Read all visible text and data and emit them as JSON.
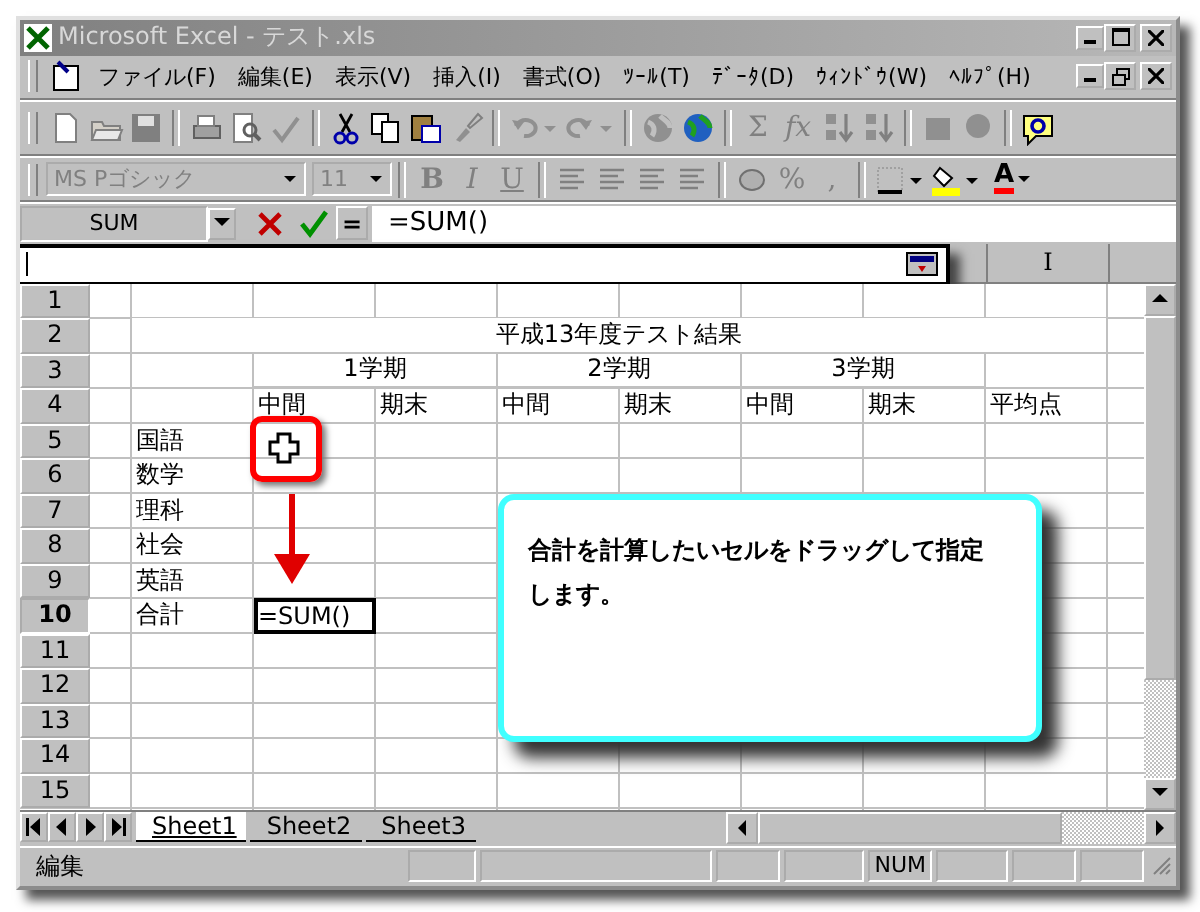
{
  "window": {
    "title": "Microsoft Excel - テスト.xls"
  },
  "menu": [
    {
      "label": "ファイル(F)"
    },
    {
      "label": "編集(E)"
    },
    {
      "label": "表示(V)"
    },
    {
      "label": "挿入(I)"
    },
    {
      "label": "書式(O)"
    },
    {
      "label": "ﾂｰﾙ(T)"
    },
    {
      "label": "ﾃﾞｰﾀ(D)"
    },
    {
      "label": "ｳｨﾝﾄﾞｳ(W)"
    },
    {
      "label": "ﾍﾙﾌﾟ(H)"
    }
  ],
  "standard_toolbar": {
    "sum_symbol": "Σ",
    "function_symbol": "fx"
  },
  "format_toolbar": {
    "font": "MS Pゴシック",
    "size": "11",
    "bold": "B",
    "italic": "I",
    "underline": "U",
    "percent": "%",
    "comma": ",",
    "font_color": "A"
  },
  "formula_bar": {
    "name_box": "SUM",
    "equals": "=",
    "formula": "=SUM()"
  },
  "column_header": "I",
  "rows": [
    {
      "header": "1",
      "kind": "cells",
      "selected": false,
      "cells": []
    },
    {
      "header": "2",
      "kind": "title",
      "selected": false,
      "text": "平成13年度テスト結果"
    },
    {
      "header": "3",
      "kind": "terms",
      "selected": false,
      "texts": [
        "1学期",
        "2学期",
        "3学期"
      ]
    },
    {
      "header": "4",
      "kind": "cells",
      "selected": false,
      "cells": [
        null,
        null,
        {
          "text": "中間",
          "selected": false
        },
        {
          "text": "期末",
          "selected": false
        },
        {
          "text": "中間",
          "selected": false
        },
        {
          "text": "期末",
          "selected": false
        },
        {
          "text": "中間",
          "selected": false
        },
        {
          "text": "期末",
          "selected": false
        },
        {
          "text": "平均点",
          "selected": false
        }
      ]
    },
    {
      "header": "5",
      "kind": "cells",
      "selected": false,
      "cells": [
        null,
        {
          "text": "国語",
          "selected": false
        }
      ]
    },
    {
      "header": "6",
      "kind": "cells",
      "selected": false,
      "cells": [
        null,
        {
          "text": "数学",
          "selected": false
        }
      ]
    },
    {
      "header": "7",
      "kind": "cells",
      "selected": false,
      "cells": [
        null,
        {
          "text": "理科",
          "selected": false
        }
      ]
    },
    {
      "header": "8",
      "kind": "cells",
      "selected": false,
      "cells": [
        null,
        {
          "text": "社会",
          "selected": false
        }
      ]
    },
    {
      "header": "9",
      "kind": "cells",
      "selected": false,
      "cells": [
        null,
        {
          "text": "英語",
          "selected": false
        }
      ]
    },
    {
      "header": "10",
      "kind": "cells",
      "selected": true,
      "cells": [
        null,
        {
          "text": "合計",
          "selected": false
        },
        {
          "text": "=SUM()",
          "selected": true
        }
      ]
    },
    {
      "header": "11",
      "kind": "cells",
      "selected": false,
      "cells": []
    },
    {
      "header": "12",
      "kind": "cells",
      "selected": false,
      "cells": []
    },
    {
      "header": "13",
      "kind": "cells",
      "selected": false,
      "cells": []
    },
    {
      "header": "14",
      "kind": "cells",
      "selected": false,
      "cells": []
    },
    {
      "header": "15",
      "kind": "cells",
      "selected": false,
      "cells": []
    }
  ],
  "callout": {
    "text": "合計を計算したいセルをドラッグして指定します。"
  },
  "sheet_tabs": [
    {
      "label": "Sheet1",
      "selected": true
    },
    {
      "label": "Sheet2",
      "selected": false
    },
    {
      "label": "Sheet3",
      "selected": false
    }
  ],
  "status_bar": {
    "mode": "編集",
    "indicators": [
      "NUM"
    ]
  }
}
